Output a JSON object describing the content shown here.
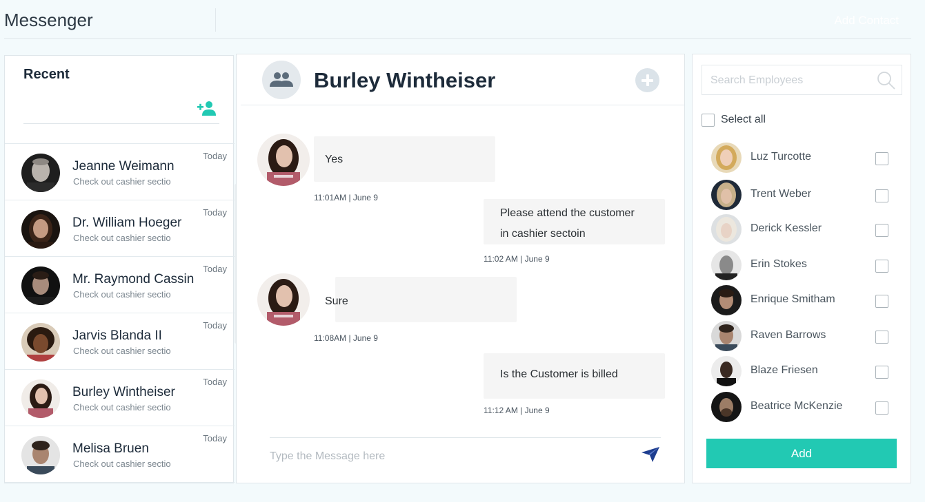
{
  "app": {
    "title": "Messenger",
    "add_contact_label": "Add Contact"
  },
  "colors": {
    "accent": "#22c9b3",
    "send": "#1d3d8f",
    "background": "#f3fafc"
  },
  "recent": {
    "title": "Recent",
    "add_icon": "add-person-icon",
    "items": [
      {
        "name": "Jeanne Weimann",
        "preview": "Check out cashier sectio",
        "time": "Today"
      },
      {
        "name": "Dr. William Hoeger",
        "preview": "Check out cashier sectio",
        "time": "Today"
      },
      {
        "name": "Mr. Raymond Cassin",
        "preview": "Check out cashier sectio",
        "time": "Today"
      },
      {
        "name": "Jarvis Blanda II",
        "preview": "Check out cashier sectio",
        "time": "Today"
      },
      {
        "name": "Burley Wintheiser",
        "preview": "Check out cashier sectio",
        "time": "Today"
      },
      {
        "name": "Melisa Bruen",
        "preview": "Check out cashier sectio",
        "time": "Today"
      }
    ]
  },
  "chat": {
    "contact_name": "Burley Wintheiser",
    "group_icon": "group-icon",
    "add_icon": "plus-circle-icon",
    "messages": [
      {
        "side": "incoming",
        "text": "Yes",
        "time": "11:01AM | June 9"
      },
      {
        "side": "outgoing",
        "text_lines": [
          "Please attend the customer",
          "in cashier sectoin"
        ],
        "time": "11:02 AM | June 9"
      },
      {
        "side": "incoming",
        "text": "Sure",
        "time": "11:08AM | June 9"
      },
      {
        "side": "outgoing",
        "text": "Is the Customer is billed",
        "time": "11:12 AM | June 9"
      }
    ],
    "compose_placeholder": "Type the Message here",
    "send_icon": "send-icon"
  },
  "employees": {
    "search_placeholder": "Search Employees",
    "search_icon": "search-icon",
    "select_all_label": "Select all",
    "items": [
      {
        "name": "Luz Turcotte",
        "checked": false
      },
      {
        "name": "Trent Weber",
        "checked": false
      },
      {
        "name": "Derick Kessler",
        "checked": false
      },
      {
        "name": "Erin Stokes",
        "checked": false
      },
      {
        "name": "Enrique Smitham",
        "checked": false
      },
      {
        "name": "Raven Barrows",
        "checked": false
      },
      {
        "name": "Blaze Friesen",
        "checked": false
      },
      {
        "name": "Beatrice McKenzie",
        "checked": false
      }
    ],
    "add_label": "Add"
  }
}
